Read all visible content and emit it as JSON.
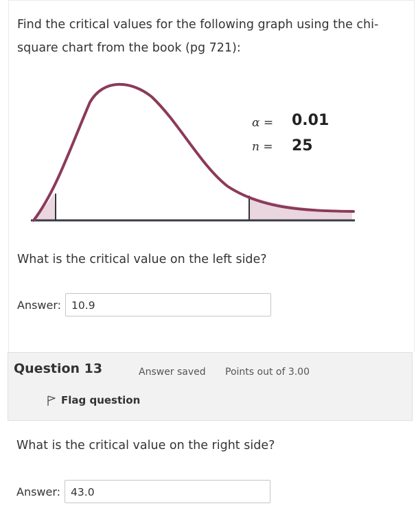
{
  "question12": {
    "prompt": "Find the critical values for the following graph using the chi-square chart from the book (pg 721):",
    "graph": {
      "alpha_symbol": "α =",
      "alpha_value": "0.01",
      "n_symbol": "n =",
      "n_value": "25",
      "curve_color": "#8b3a5a",
      "shade_color": "#ead6df"
    },
    "sub_question": "What is the critical value on the left side?",
    "answer_label": "Answer:",
    "answer_value": "10.9"
  },
  "question13": {
    "number_label": "Question 13",
    "state": "Answer saved",
    "grade": "Points out of 3.00",
    "flag_label": "Flag question",
    "flag_icon": "flag-icon",
    "sub_question": "What is the critical value on the right side?",
    "answer_label": "Answer:",
    "answer_value": "43.0"
  }
}
